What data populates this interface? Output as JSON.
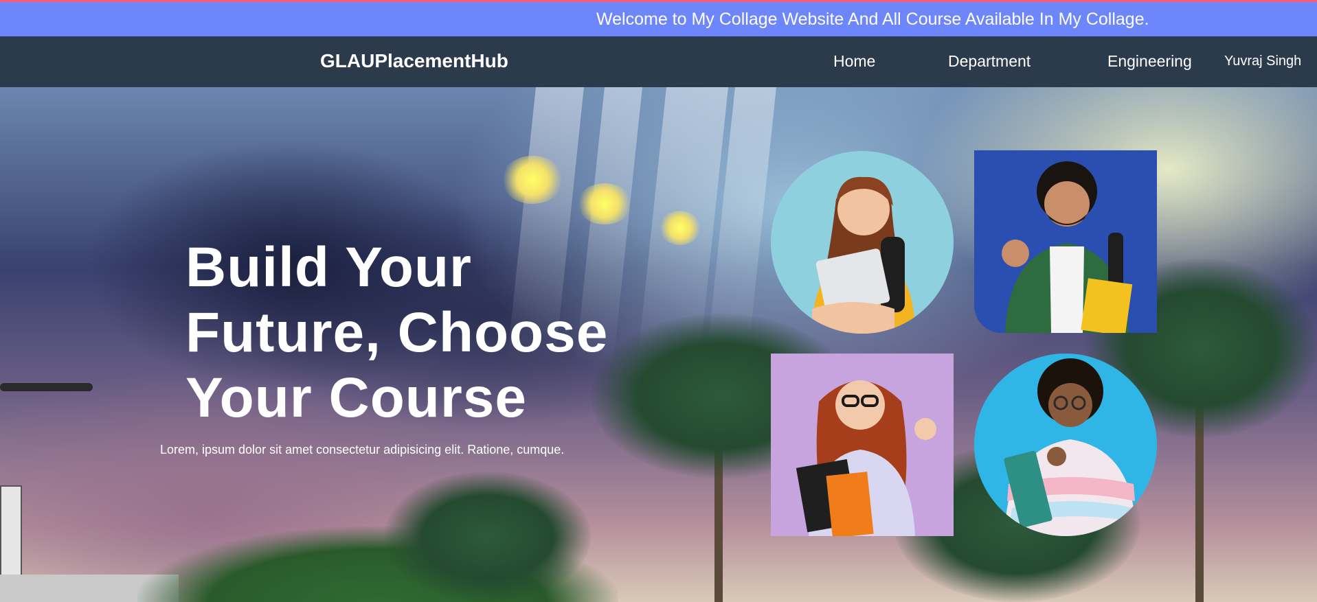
{
  "banner": {
    "text": "Welcome to My Collage Website And All Course Available In My Collage."
  },
  "navbar": {
    "brand": "GLAUPlacementHub",
    "links": [
      {
        "label": "Home"
      },
      {
        "label": "Department"
      },
      {
        "label": "Engineering"
      }
    ],
    "user": "Yuvraj Singh"
  },
  "hero": {
    "title_lines": [
      "Build Your",
      "Future, Choose",
      "Your Course"
    ],
    "subtitle": "Lorem, ipsum dolor sit amet consectetur adipisicing elit. Ratione, cumque."
  },
  "colors": {
    "banner_bg": "#6d86fb",
    "navbar_bg": "#2c3b4c",
    "text": "#ffffff"
  },
  "images": [
    {
      "name": "student-photo-1",
      "shape": "circle"
    },
    {
      "name": "student-photo-2",
      "shape": "square"
    },
    {
      "name": "student-photo-3",
      "shape": "square"
    },
    {
      "name": "student-photo-4",
      "shape": "circle"
    }
  ]
}
